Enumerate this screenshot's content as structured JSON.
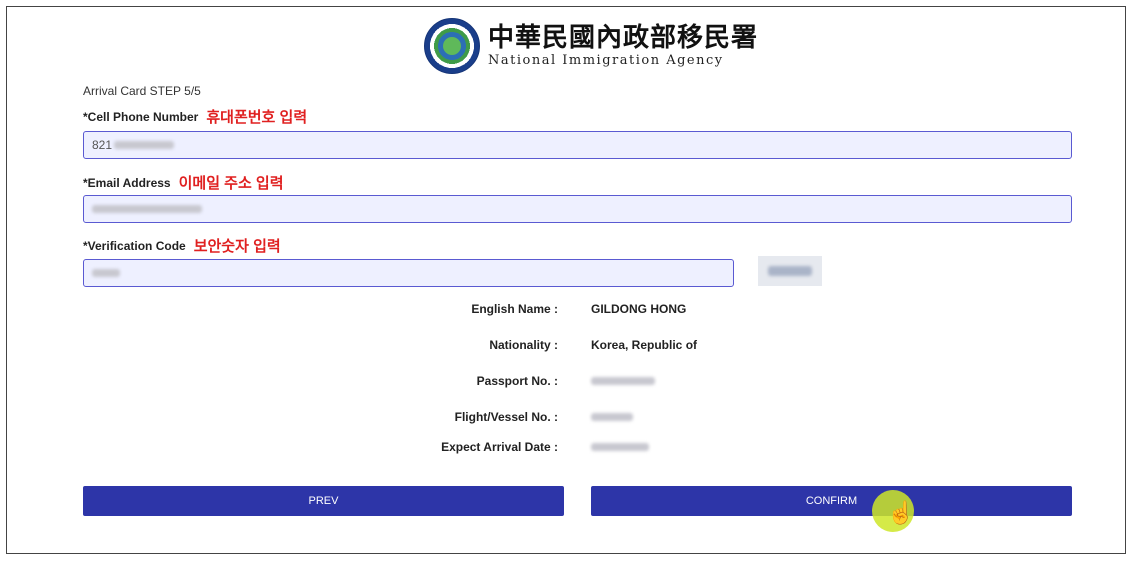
{
  "header": {
    "agency_zh": "中華民國內政部移民署",
    "agency_en": "National Immigration Agency"
  },
  "step": "Arrival Card STEP 5/5",
  "fields": {
    "phone": {
      "label": "*Cell Phone Number",
      "annotation": "휴대폰번호 입력",
      "value": "821"
    },
    "email": {
      "label": "*Email Address",
      "annotation": "이메일 주소 입력",
      "value": ""
    },
    "verification": {
      "label": "*Verification Code",
      "annotation": "보안숫자 입력",
      "value": ""
    }
  },
  "info": {
    "english_name": {
      "label": "English Name :",
      "value": "GILDONG HONG"
    },
    "nationality": {
      "label": "Nationality :",
      "value": "Korea, Republic of"
    },
    "passport": {
      "label": "Passport No. :",
      "value": ""
    },
    "flight": {
      "label": "Flight/Vessel No. :",
      "value": ""
    },
    "arrival_date": {
      "label": "Expect Arrival Date :",
      "value": ""
    }
  },
  "buttons": {
    "prev": "PREV",
    "confirm": "CONFIRM"
  },
  "colors": {
    "button": "#2d35a8",
    "annotation": "#e02020",
    "field_border": "#5a5ad2",
    "cursor_highlight": "#cee628"
  },
  "icons": {
    "cursor": "hand-pointer-icon",
    "emblem": "agency-emblem-icon"
  }
}
